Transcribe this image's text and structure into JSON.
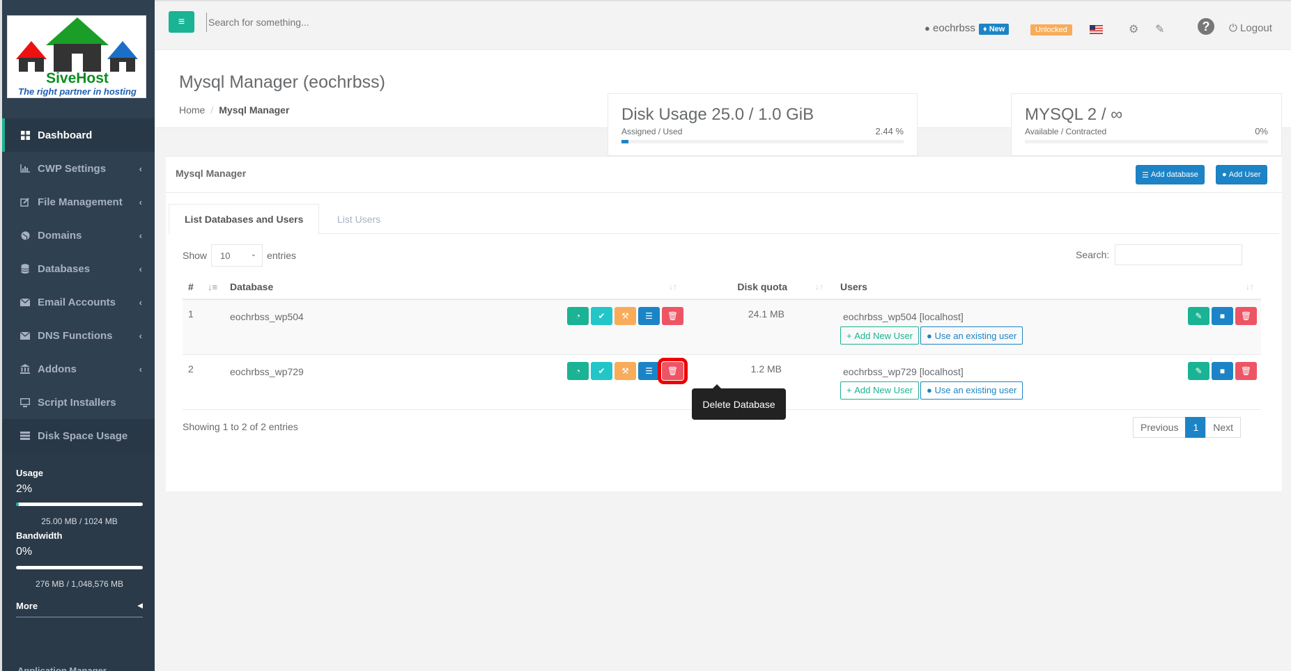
{
  "logo": {
    "name": "SiveHost",
    "tagline": "The right partner in hosting"
  },
  "sidebar": {
    "items": [
      {
        "label": "Dashboard",
        "icon": "dashboard-icon",
        "has_chevron": false
      },
      {
        "label": "CWP Settings",
        "icon": "chart-icon",
        "has_chevron": true
      },
      {
        "label": "File Management",
        "icon": "edit-icon",
        "has_chevron": true
      },
      {
        "label": "Domains",
        "icon": "globe-icon",
        "has_chevron": true
      },
      {
        "label": "Databases",
        "icon": "database-icon",
        "has_chevron": true
      },
      {
        "label": "Email Accounts",
        "icon": "envelope-icon",
        "has_chevron": true
      },
      {
        "label": "DNS Functions",
        "icon": "envelope-icon",
        "has_chevron": true
      },
      {
        "label": "Addons",
        "icon": "bank-icon",
        "has_chevron": true
      },
      {
        "label": "Script Installers",
        "icon": "monitor-icon",
        "has_chevron": false
      },
      {
        "label": "Disk Space Usage",
        "icon": "hdd-icon",
        "has_chevron": false
      }
    ],
    "usage": {
      "usage_label": "Usage",
      "usage_pct": "2%",
      "usage_fraction": 0.02,
      "usage_detail": "25.00 MB / 1024 MB",
      "bandwidth_label": "Bandwidth",
      "bandwidth_pct": "0%",
      "bandwidth_fraction": 0.0,
      "bandwidth_detail": "276 MB / 1,048,576 MB",
      "more_label": "More",
      "cut_label": "Application Manager"
    }
  },
  "topbar": {
    "search_placeholder": "Search for something...",
    "username": "eochrbss",
    "new_badge": "New",
    "unlocked_badge": "Unlocked",
    "help": "?",
    "logout": "Logout"
  },
  "page": {
    "title": "Mysql Manager (eochrbss)",
    "breadcrumb_home": "Home",
    "breadcrumb_current": "Mysql Manager"
  },
  "stats": {
    "disk": {
      "title": "Disk Usage 25.0 / 1.0 GiB",
      "sub": "Assigned / Used",
      "pct": "2.44 %",
      "fraction": 0.0244
    },
    "mysql": {
      "title": "MYSQL 2 / ∞",
      "sub": "Available / Contracted",
      "pct": "0%",
      "fraction": 0
    }
  },
  "panel": {
    "title": "Mysql Manager",
    "add_database": "Add database",
    "add_user": "Add User",
    "tab_active": "List Databases and Users",
    "tab_inactive": "List Users",
    "show_label": "Show",
    "show_value": "10",
    "entries_label": "entries",
    "search_label": "Search:",
    "headers": {
      "num": "#",
      "database": "Database",
      "quota": "Disk quota",
      "users": "Users"
    },
    "rows": [
      {
        "num": "1",
        "database": "eochrbss_wp504",
        "quota": "24.1 MB",
        "user": "eochrbss_wp504 [localhost]"
      },
      {
        "num": "2",
        "database": "eochrbss_wp729",
        "quota": "1.2 MB",
        "user": "eochrbss_wp729 [localhost]"
      }
    ],
    "add_new_user": "Add New User",
    "use_existing_user": "Use an existing user",
    "tooltip": "Delete Database",
    "info": "Showing 1 to 2 of 2 entries",
    "prev": "Previous",
    "page": "1",
    "next": "Next"
  },
  "colors": {
    "green": "#1ab394",
    "blue": "#1c84c6",
    "orange": "#f8ac59",
    "red": "#ed5565",
    "cyan": "#23c6c8",
    "sidebar": "#2f4050"
  }
}
